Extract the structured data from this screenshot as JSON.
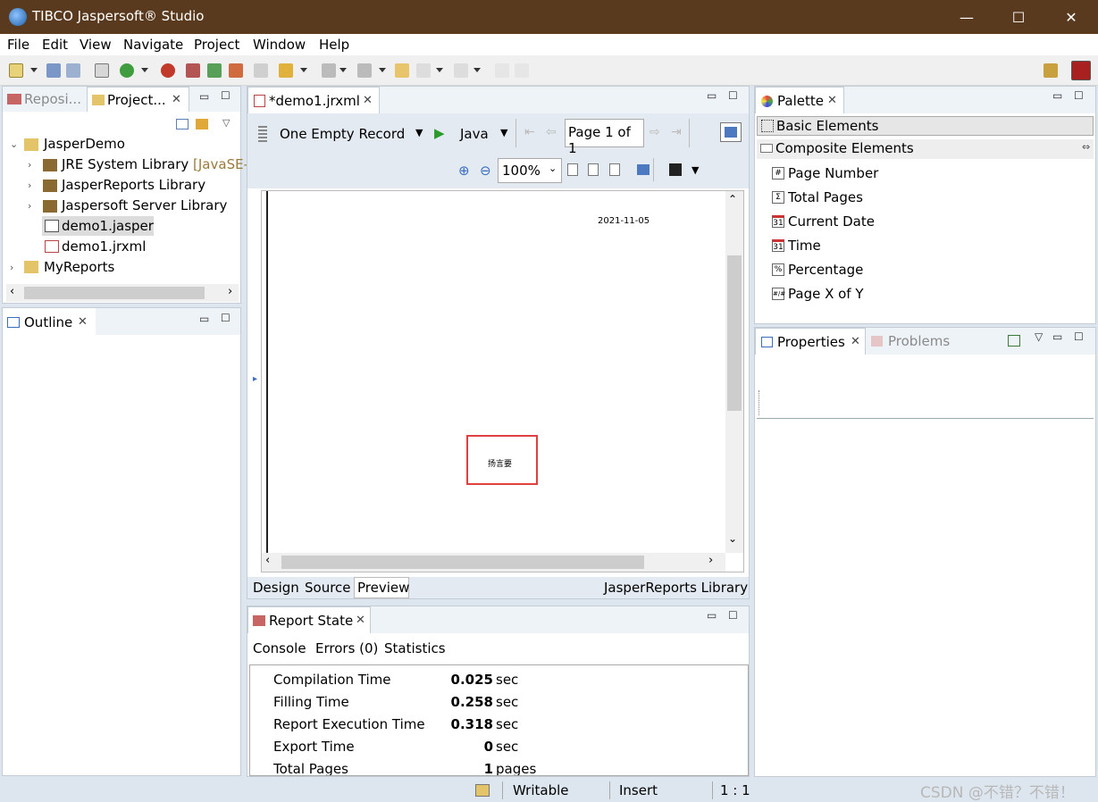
{
  "window": {
    "title": "TIBCO Jaspersoft® Studio",
    "minimize": "—",
    "maximize": "☐",
    "close": "✕"
  },
  "menu": [
    "File",
    "Edit",
    "View",
    "Navigate",
    "Project",
    "Window",
    "Help"
  ],
  "left_panel": {
    "tabs": [
      "Reposi...",
      "Project..."
    ],
    "tree": [
      {
        "label": "JasperDemo"
      },
      {
        "label": "JRE System Library",
        "suffix": "[JavaSE-"
      },
      {
        "label": "JasperReports Library"
      },
      {
        "label": "Jaspersoft Server Library"
      },
      {
        "label": "demo1.jasper"
      },
      {
        "label": "demo1.jrxml"
      },
      {
        "label": "MyReports"
      }
    ]
  },
  "outline": {
    "tab": "Outline"
  },
  "editor": {
    "tab": "*demo1.jrxml",
    "datasource": "One Empty Record",
    "language": "Java",
    "page_indicator": "Page 1 of 1",
    "zoom": "100%",
    "report_date": "2021-11-05",
    "report_text": "扬言要",
    "bottom_tabs": [
      "Design",
      "Source",
      "Preview"
    ],
    "library_label": "JasperReports Library"
  },
  "report_state": {
    "tab": "Report State",
    "subtabs": [
      "Console",
      "Errors (0)",
      "Statistics"
    ],
    "rows": [
      {
        "label": "Compilation Time",
        "value": "0.025",
        "unit": "sec"
      },
      {
        "label": "Filling Time",
        "value": "0.258",
        "unit": "sec"
      },
      {
        "label": "Report Execution Time",
        "value": "0.318",
        "unit": "sec"
      },
      {
        "label": "Export Time",
        "value": "0",
        "unit": "sec"
      },
      {
        "label": "Total Pages",
        "value": "1",
        "unit": "pages"
      }
    ]
  },
  "palette": {
    "tab": "Palette",
    "groups": [
      "Basic Elements",
      "Composite Elements"
    ],
    "items": [
      {
        "label": "Page Number",
        "icon": "#"
      },
      {
        "label": "Total Pages",
        "icon": "Σ"
      },
      {
        "label": "Current Date",
        "icon": "31"
      },
      {
        "label": "Time",
        "icon": "31"
      },
      {
        "label": "Percentage",
        "icon": "%"
      },
      {
        "label": "Page X of Y",
        "icon": "#/#"
      }
    ]
  },
  "properties": {
    "tabs": [
      "Properties",
      "Problems"
    ]
  },
  "status_bar": {
    "mode": "Writable",
    "insert": "Insert",
    "position": "1 : 1"
  },
  "watermark": "CSDN @不错？不错！"
}
